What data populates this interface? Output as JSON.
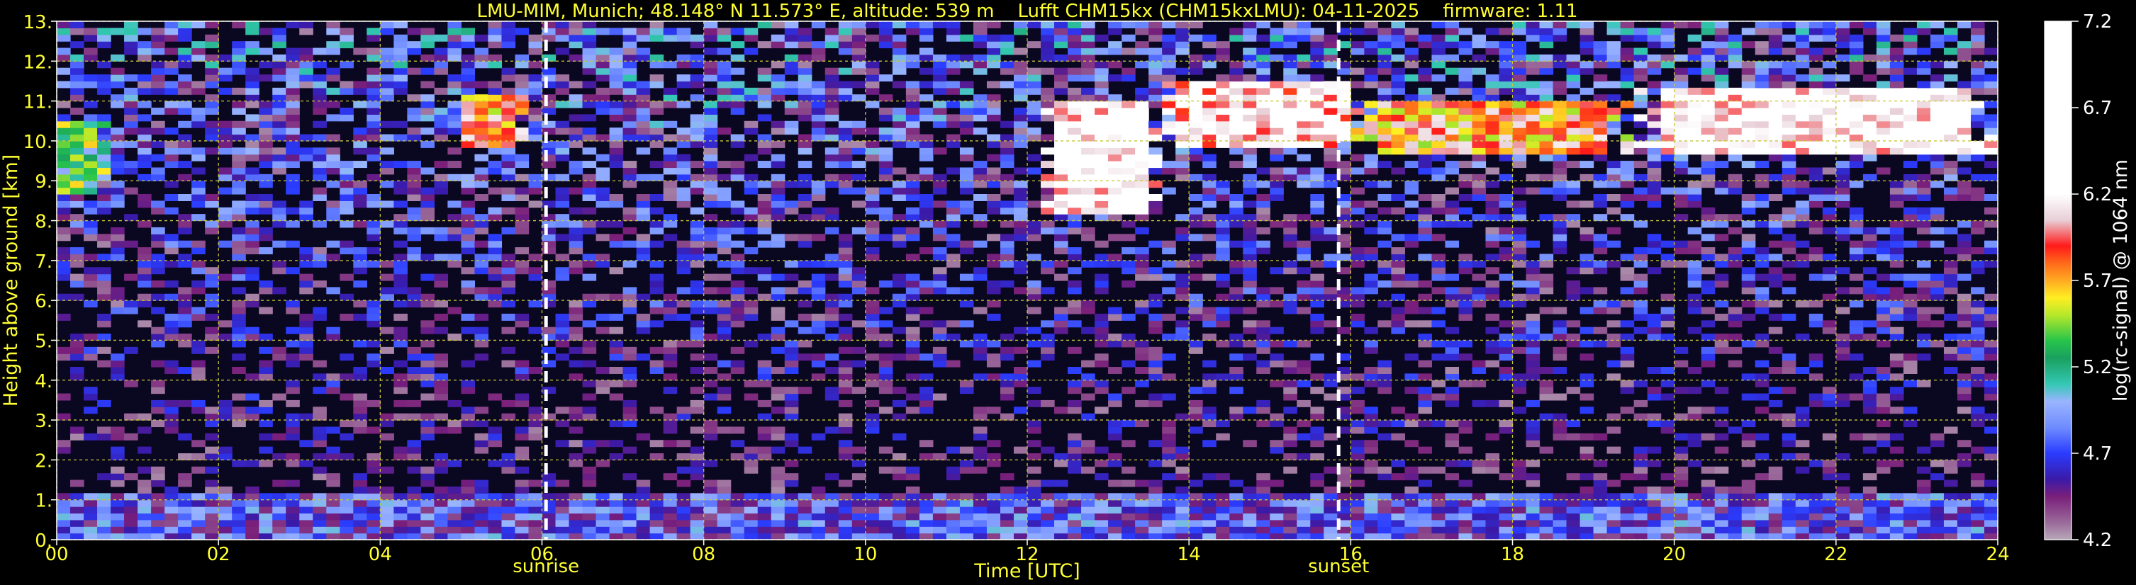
{
  "chart_data": {
    "type": "heatmap",
    "title": "LMU-MIM, Munich; 48.148° N 11.573° E, altitude: 539 m    Lufft CHM15kx (CHM15kxLMU): 04-11-2025    firmware: 1.11",
    "xlabel": "Time [UTC]",
    "ylabel": "Height above ground [km]",
    "xlim": [
      0,
      24
    ],
    "ylim": [
      0,
      13
    ],
    "x_ticks": [
      0,
      2,
      4,
      6,
      8,
      10,
      12,
      14,
      16,
      18,
      20,
      22,
      24
    ],
    "x_tick_labels": [
      "00",
      "02",
      "04",
      "06",
      "08",
      "10",
      "12",
      "14",
      "16",
      "18",
      "20",
      "22",
      "24"
    ],
    "y_ticks": [
      0,
      1,
      2,
      3,
      4,
      5,
      6,
      7,
      8,
      9,
      10,
      11,
      12,
      13
    ],
    "y_tick_labels": [
      "0.",
      "1.",
      "2.",
      "3.",
      "4.",
      "5.",
      "6.",
      "7.",
      "8.",
      "9.",
      "10.",
      "11.",
      "12.",
      "13."
    ],
    "grid": true,
    "markers": [
      {
        "label": "sunrise",
        "x": 6.05
      },
      {
        "label": "sunset",
        "x": 15.85
      }
    ],
    "colorbar": {
      "label": "log(rc-signal) @ 1064 nm",
      "range": [
        4.2,
        7.2
      ],
      "ticks": [
        "4.2",
        "4.7",
        "5.2",
        "5.7",
        "6.2",
        "6.7",
        "7.2"
      ],
      "tick_values": [
        4.2,
        4.7,
        5.2,
        5.7,
        6.2,
        6.7,
        7.2
      ],
      "stops": [
        {
          "v": 4.2,
          "color": "#b8a8b8"
        },
        {
          "v": 4.3,
          "color": "#9a6a9a"
        },
        {
          "v": 4.45,
          "color": "#7a1f7a"
        },
        {
          "v": 4.55,
          "color": "#3a1aa8"
        },
        {
          "v": 4.7,
          "color": "#2a3cff"
        },
        {
          "v": 4.85,
          "color": "#6f8cff"
        },
        {
          "v": 5.0,
          "color": "#9ab4ff"
        },
        {
          "v": 5.1,
          "color": "#34c8b4"
        },
        {
          "v": 5.25,
          "color": "#1aa060"
        },
        {
          "v": 5.35,
          "color": "#26c44a"
        },
        {
          "v": 5.5,
          "color": "#b6e82a"
        },
        {
          "v": 5.6,
          "color": "#ffee22"
        },
        {
          "v": 5.7,
          "color": "#ffaa22"
        },
        {
          "v": 5.8,
          "color": "#ff6a1a"
        },
        {
          "v": 5.9,
          "color": "#ff1a1a"
        },
        {
          "v": 6.05,
          "color": "#e8d0d8"
        },
        {
          "v": 6.2,
          "color": "#ffffff"
        },
        {
          "v": 7.2,
          "color": "#ffffff"
        }
      ]
    },
    "features": [
      {
        "name": "boundary layer",
        "t": [
          0,
          24
        ],
        "h": [
          0,
          1.1
        ],
        "level": 4.7
      },
      {
        "name": "cirrus",
        "t": [
          5.0,
          5.8
        ],
        "h": [
          9.8,
          11.2
        ],
        "level": 5.8
      },
      {
        "name": "cirrus",
        "t": [
          0,
          0.6
        ],
        "h": [
          8.6,
          10.5
        ],
        "level": 5.3
      },
      {
        "name": "cirrus",
        "t": [
          12.2,
          13.6
        ],
        "h": [
          8.2,
          11.0
        ],
        "level": 6.3
      },
      {
        "name": "cirrus",
        "t": [
          13.6,
          16.0
        ],
        "h": [
          9.9,
          11.5
        ],
        "level": 6.2
      },
      {
        "name": "cirrus",
        "t": [
          16.0,
          19.5
        ],
        "h": [
          9.7,
          11.0
        ],
        "level": 5.8
      },
      {
        "name": "cirrus",
        "t": [
          19.5,
          24.0
        ],
        "h": [
          9.6,
          11.4
        ],
        "level": 6.3
      }
    ]
  }
}
